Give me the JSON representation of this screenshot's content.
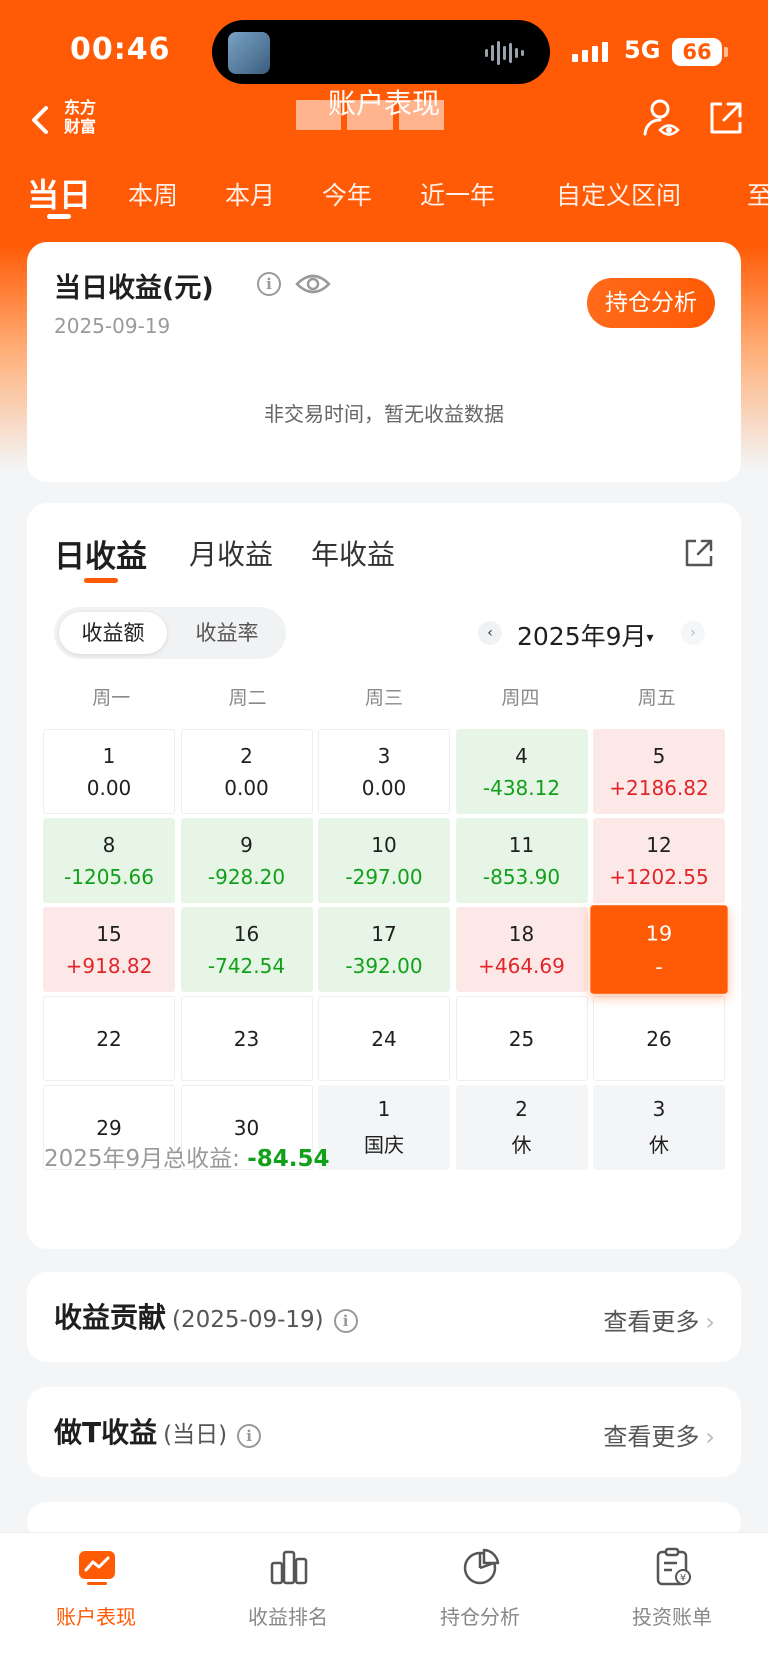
{
  "status_bar": {
    "time": "00:46",
    "network": "5G",
    "battery": "66"
  },
  "header": {
    "logo": "东方财富",
    "title": "账户表现"
  },
  "period_tabs": [
    "当日",
    "本周",
    "本月",
    "今年",
    "近一年",
    "自定义区间",
    "至"
  ],
  "daily_card": {
    "title": "当日收益(元)",
    "date": "2025-09-19",
    "holdings_button": "持仓分析",
    "empty_message": "非交易时间，暂无收益数据"
  },
  "calendar_card": {
    "tabs": [
      "日收益",
      "月收益",
      "年收益"
    ],
    "toggle": [
      "收益额",
      "收益率"
    ],
    "prev_arrow": "‹",
    "next_arrow": "›",
    "month": "2025年9月",
    "caret": "▾",
    "weekdays": [
      "周一",
      "周二",
      "周三",
      "周四",
      "周五"
    ],
    "cells": [
      {
        "day": "1",
        "value": "0.00",
        "type": "flat"
      },
      {
        "day": "2",
        "value": "0.00",
        "type": "flat"
      },
      {
        "day": "3",
        "value": "0.00",
        "type": "flat"
      },
      {
        "day": "4",
        "value": "-438.12",
        "type": "loss"
      },
      {
        "day": "5",
        "value": "+2186.82",
        "type": "gain"
      },
      {
        "day": "8",
        "value": "-1205.66",
        "type": "loss"
      },
      {
        "day": "9",
        "value": "-928.20",
        "type": "loss"
      },
      {
        "day": "10",
        "value": "-297.00",
        "type": "loss"
      },
      {
        "day": "11",
        "value": "-853.90",
        "type": "loss"
      },
      {
        "day": "12",
        "value": "+1202.55",
        "type": "gain"
      },
      {
        "day": "15",
        "value": "+918.82",
        "type": "gain"
      },
      {
        "day": "16",
        "value": "-742.54",
        "type": "loss"
      },
      {
        "day": "17",
        "value": "-392.00",
        "type": "loss"
      },
      {
        "day": "18",
        "value": "+464.69",
        "type": "gain"
      },
      {
        "day": "19",
        "value": "-",
        "type": "today"
      },
      {
        "day": "22",
        "value": "",
        "type": "empty"
      },
      {
        "day": "23",
        "value": "",
        "type": "empty"
      },
      {
        "day": "24",
        "value": "",
        "type": "empty"
      },
      {
        "day": "25",
        "value": "",
        "type": "empty"
      },
      {
        "day": "26",
        "value": "",
        "type": "empty"
      },
      {
        "day": "29",
        "value": "",
        "type": "empty"
      },
      {
        "day": "30",
        "value": "",
        "type": "empty"
      },
      {
        "day": "1",
        "value": "国庆",
        "type": "holiday"
      },
      {
        "day": "2",
        "value": "休",
        "type": "holiday"
      },
      {
        "day": "3",
        "value": "休",
        "type": "holiday"
      }
    ],
    "total_label": "2025年9月总收益:",
    "total_value": "-84.54"
  },
  "contribution": {
    "title": "收益贡献",
    "subtitle": "(2025-09-19)",
    "more": "查看更多"
  },
  "t_profit": {
    "title": "做T收益",
    "subtitle": "(当日)",
    "more": "查看更多"
  },
  "info_glyph": "i",
  "chevron_glyph": "›",
  "bottom_nav": [
    {
      "label": "账户表现",
      "active": true
    },
    {
      "label": "收益排名",
      "active": false
    },
    {
      "label": "持仓分析",
      "active": false
    },
    {
      "label": "投资账单",
      "active": false
    }
  ],
  "colors": {
    "brand": "#ff5a05",
    "gain": "#e0262b",
    "loss": "#12a01a"
  }
}
